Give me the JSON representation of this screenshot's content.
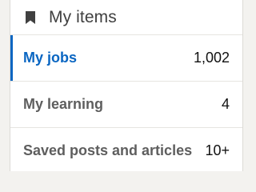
{
  "header": {
    "title": "My items",
    "icon": "bookmark-icon"
  },
  "items": [
    {
      "label": "My jobs",
      "count": "1,002",
      "active": true
    },
    {
      "label": "My learning",
      "count": "4",
      "active": false
    },
    {
      "label": "Saved posts and articles",
      "count": "10+",
      "active": false
    }
  ],
  "colors": {
    "accent": "#0a66c2",
    "text_muted": "#5e5e5e",
    "background": "#f3f2ef"
  }
}
